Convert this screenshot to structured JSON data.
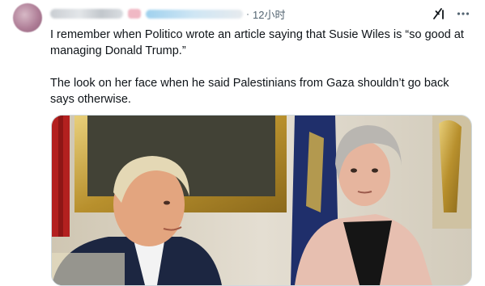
{
  "post": {
    "time": "12小时",
    "separator": "·",
    "text_line1": "I remember when Politico wrote an article saying that Susie Wiles is “so good at managing Donald Trump.”",
    "text_line2": "The look on her face when he said Palestinians from Gaza shouldn’t go back says otherwise."
  },
  "icons": {
    "grok": "grok-icon",
    "more": "more-icon"
  },
  "colors": {
    "text": "#0f1419",
    "muted": "#536471",
    "border": "#cfd9de"
  }
}
